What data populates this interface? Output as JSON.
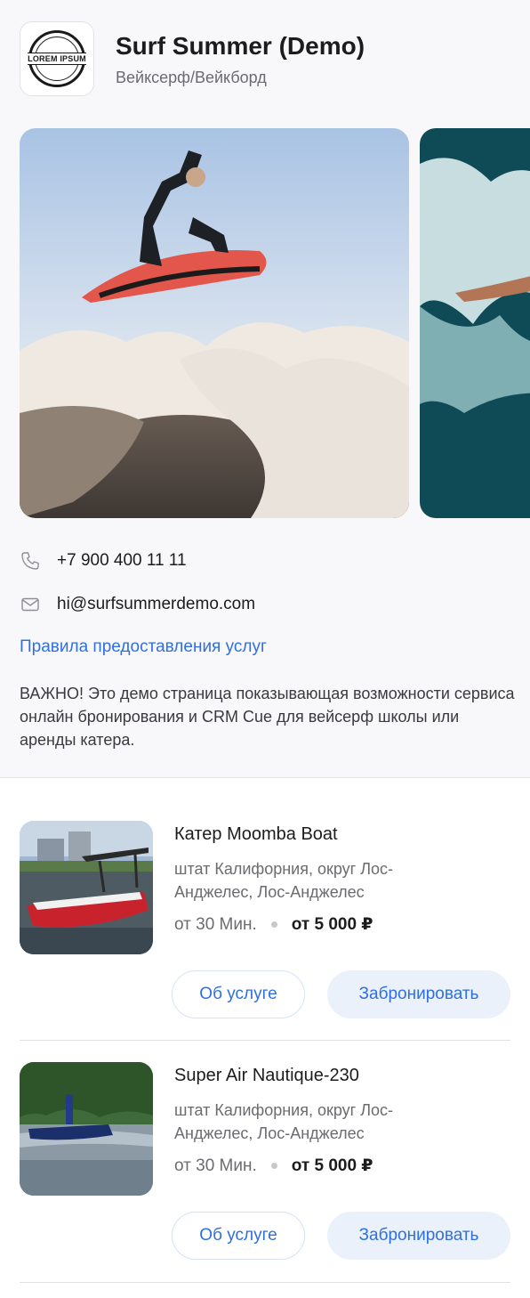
{
  "header": {
    "logo_text": "LOREM IPSUM",
    "title": "Surf Summer (Demo)",
    "subtitle": "Вейксерф/Вейкборд"
  },
  "contacts": {
    "phone": "+7 900 400 11 11",
    "email": "hi@surfsummerdemo.com",
    "rules_link": "Правила предоставления услуг",
    "note": "ВАЖНО! Это демо страница показывающая возможности сервиса онлайн бронирования и CRM Cue для вейсерф школы или аренды катера."
  },
  "services": [
    {
      "title": "Катер Moomba Boat",
      "location": "штат Калифорния, округ Лос-Анджелес, Лос-Анджелес",
      "duration": "от 30 Мин.",
      "price": "от 5 000 ₽",
      "about_label": "Об услуге",
      "book_label": "Забронировать"
    },
    {
      "title": "Super Air Nautique-230",
      "location": "штат Калифорния, округ Лос-Анджелес, Лос-Анджелес",
      "duration": "от 30 Мин.",
      "price": "от 5 000 ₽",
      "about_label": "Об услуге",
      "book_label": "Забронировать"
    }
  ],
  "colors": {
    "accent": "#2f6fe0",
    "button_fill": "#eaf1fb",
    "muted_text": "#6b6b70"
  },
  "icons": [
    "phone-icon",
    "mail-icon"
  ]
}
